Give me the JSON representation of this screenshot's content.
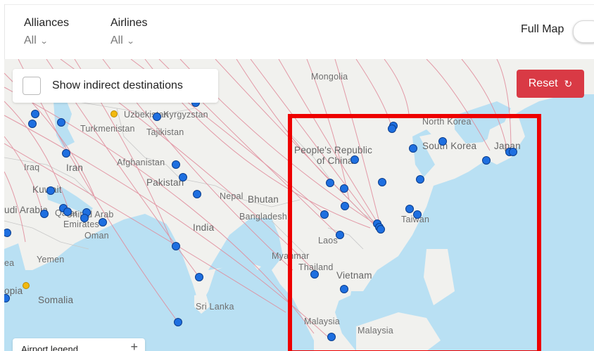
{
  "filters": {
    "alliances": {
      "label": "Alliances",
      "value": "All"
    },
    "airlines": {
      "label": "Airlines",
      "value": "All"
    }
  },
  "full_map": {
    "label": "Full Map",
    "enabled": false
  },
  "map": {
    "indirect_label": "Show indirect destinations",
    "reset_label": "Reset",
    "legend_label": "Airport legend",
    "countries": {
      "mongolia": "Mongolia",
      "uzbekistan": "Uzbekistan",
      "kyrgyzstan": "Kyrgyzstan",
      "turkmenistan": "Turkmenistan",
      "tajikistan": "Tajikistan",
      "north_korea": "North Korea",
      "south_korea": "South Korea",
      "japan": "Japan",
      "china_line1": "People's Republic",
      "china_line2": "of China",
      "afghanistan": "Afghanistan",
      "iran": "Iran",
      "iraq": "Iraq",
      "kuwait": "Kuwait",
      "pakistan": "Pakistan",
      "nepal": "Nepal",
      "bhutan": "Bhutan",
      "bangladesh": "Bangladesh",
      "saudi_arabia": "udi Arabia",
      "qatar": "Qatar",
      "uae_line1": "United Arab",
      "uae_line2": "Emirates",
      "oman": "Oman",
      "india": "India",
      "taiwan": "Taiwan",
      "laos": "Laos",
      "myanmar": "Myanmar",
      "thailand": "Thailand",
      "vietnam": "Vietnam",
      "yemen": "Yemen",
      "sri_lanka": "Sri Lanka",
      "somalia": "Somalia",
      "ethiopia": "opia",
      "eritrea": "ea",
      "malaysia1": "Malaysia",
      "malaysia2": "Malaysia"
    }
  },
  "colors": {
    "reset": "#d93a45",
    "airport_marker": "#1e6fe0",
    "airport_marker_alt": "#f2b90f",
    "route_line": "#e08a9a",
    "water": "#b9e0f3",
    "land": "#f1f1ee",
    "highlight": "#ee0000"
  },
  "icons": {
    "reset": "refresh-icon",
    "dropdown": "chevron-down-icon",
    "legend_expand": "plus-icon"
  }
}
